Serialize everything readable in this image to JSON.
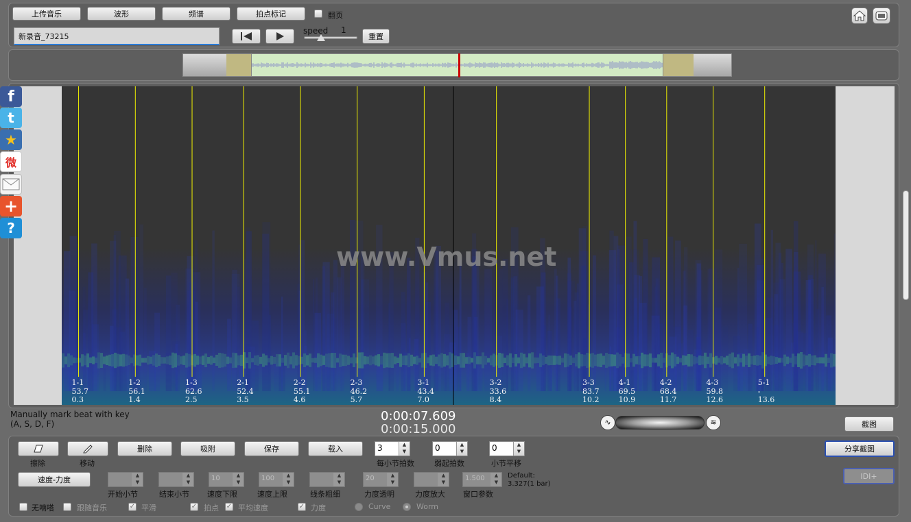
{
  "toolbar": {
    "upload": "上传音乐",
    "waveform": "波形",
    "spectrum": "频谱",
    "beat_mark": "拍点标记",
    "page_turn": "翻页",
    "filename": "新录音_73215",
    "speed_label": "speed",
    "speed_value": "1",
    "reset": "重置"
  },
  "watermark": "www.Vmus.net",
  "beats": [
    {
      "id": "1-1",
      "bpm": "53.7",
      "t": "0.3"
    },
    {
      "id": "1-2",
      "bpm": "56.1",
      "t": "1.4"
    },
    {
      "id": "1-3",
      "bpm": "62.6",
      "t": "2.5"
    },
    {
      "id": "2-1",
      "bpm": "52.4",
      "t": "3.5"
    },
    {
      "id": "2-2",
      "bpm": "55.1",
      "t": "4.6"
    },
    {
      "id": "2-3",
      "bpm": "46.2",
      "t": "5.7"
    },
    {
      "id": "3-1",
      "bpm": "43.4",
      "t": "7.0"
    },
    {
      "id": "3-2",
      "bpm": "33.6",
      "t": "8.4"
    },
    {
      "id": "3-3",
      "bpm": "83.7",
      "t": "10.2"
    },
    {
      "id": "4-1",
      "bpm": "69.5",
      "t": "10.9"
    },
    {
      "id": "4-2",
      "bpm": "68.4",
      "t": "11.7"
    },
    {
      "id": "4-3",
      "bpm": "59.8",
      "t": "12.6"
    },
    {
      "id": "5-1",
      "bpm": "-",
      "t": "13.6"
    }
  ],
  "info": {
    "hint_line1": "Manually mark beat with key",
    "hint_line2": "(A, S, D, F)",
    "current_time": "0:00:07.609",
    "total_time": "0:00:15.000",
    "screenshot": "截图"
  },
  "controls": {
    "erase": "擦除",
    "move": "移动",
    "delete": "删除",
    "snap": "吸附",
    "save": "保存",
    "load": "载入",
    "beats_per_bar_value": "3",
    "beats_per_bar_label": "每小节拍数",
    "pickup_value": "0",
    "pickup_label": "弱起拍数",
    "bar_shift_value": "0",
    "bar_shift_label": "小节平移",
    "share": "分享截图",
    "idi": "IDI+",
    "speed_force": "速度-力度",
    "start_bar": "开始小节",
    "end_bar": "结束小节",
    "speed_min": "速度下限",
    "speed_min_value": "10",
    "speed_max": "速度上限",
    "speed_max_value": "100",
    "line_width": "线条粗细",
    "force_alpha": "力度透明",
    "force_alpha_value": "20",
    "force_zoom": "力度放大",
    "window_param": "窗口参数",
    "window_param_value": "1.500",
    "default_label": "Default:",
    "default_value": "3.327(1 bar)",
    "no_tick": "无嘀嗒",
    "follow_music": "跟随音乐",
    "smooth": "平滑",
    "beat_point": "拍点",
    "avg_speed": "平均速度",
    "force": "力度",
    "curve": "Curve",
    "worm": "Worm"
  }
}
